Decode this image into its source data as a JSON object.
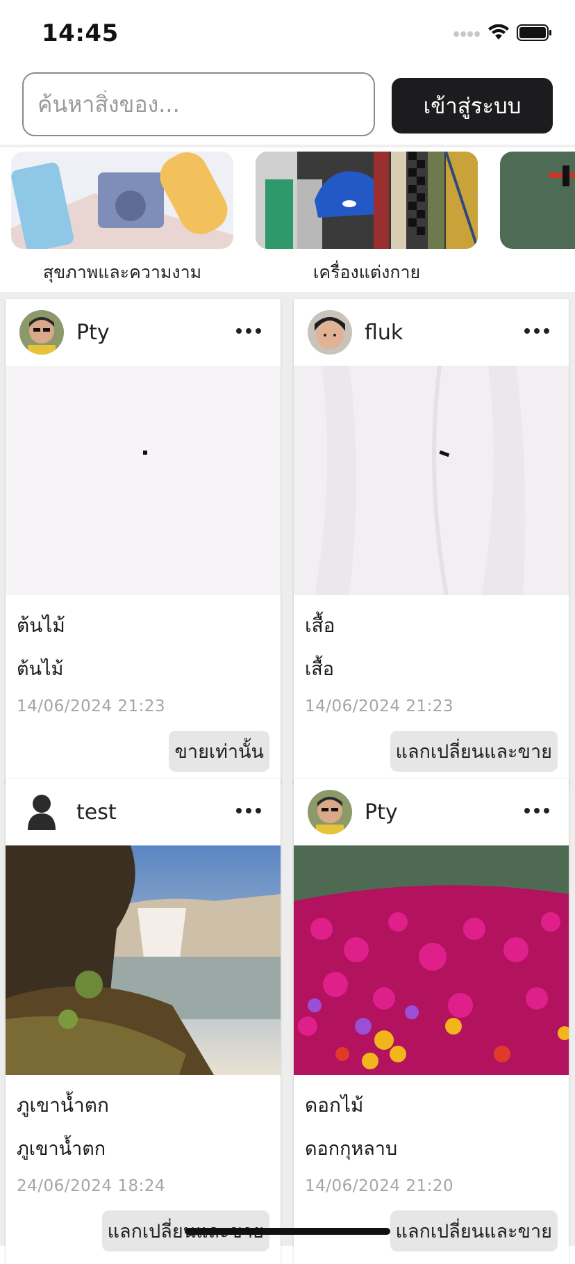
{
  "status_bar": {
    "time": "14:45"
  },
  "header": {
    "search_placeholder": "ค้นหาสิ่งของ...",
    "login_label": "เข้าสู่ระบบ"
  },
  "categories": [
    {
      "label": "สุขภาพและความงาม"
    },
    {
      "label": "เครื่องแต่งกาย"
    },
    {
      "label": ""
    }
  ],
  "posts": [
    {
      "username": "Pty",
      "title": "ต้นไม้",
      "subtitle": "ต้นไม้",
      "date": "14/06/2024 21:23",
      "badge": "ขายเท่านั้น"
    },
    {
      "username": "fluk",
      "title": "เสื้อ",
      "subtitle": "เสื้อ",
      "date": "14/06/2024 21:23",
      "badge": "แลกเปลี่ยนและขาย"
    },
    {
      "username": "test",
      "title": "ภูเขาน้ำตก",
      "subtitle": "ภูเขาน้ำตก",
      "date": "24/06/2024 18:24",
      "badge": "แลกเปลี่ยนและขาย"
    },
    {
      "username": "Pty",
      "title": "ดอกไม้",
      "subtitle": "ดอกกุหลาบ",
      "date": "14/06/2024 21:20",
      "badge": "แลกเปลี่ยนและขาย"
    }
  ],
  "colors": {
    "primary_button": "#1c1c1e",
    "feed_background": "#ededed",
    "badge_background": "#e6e6e6"
  }
}
